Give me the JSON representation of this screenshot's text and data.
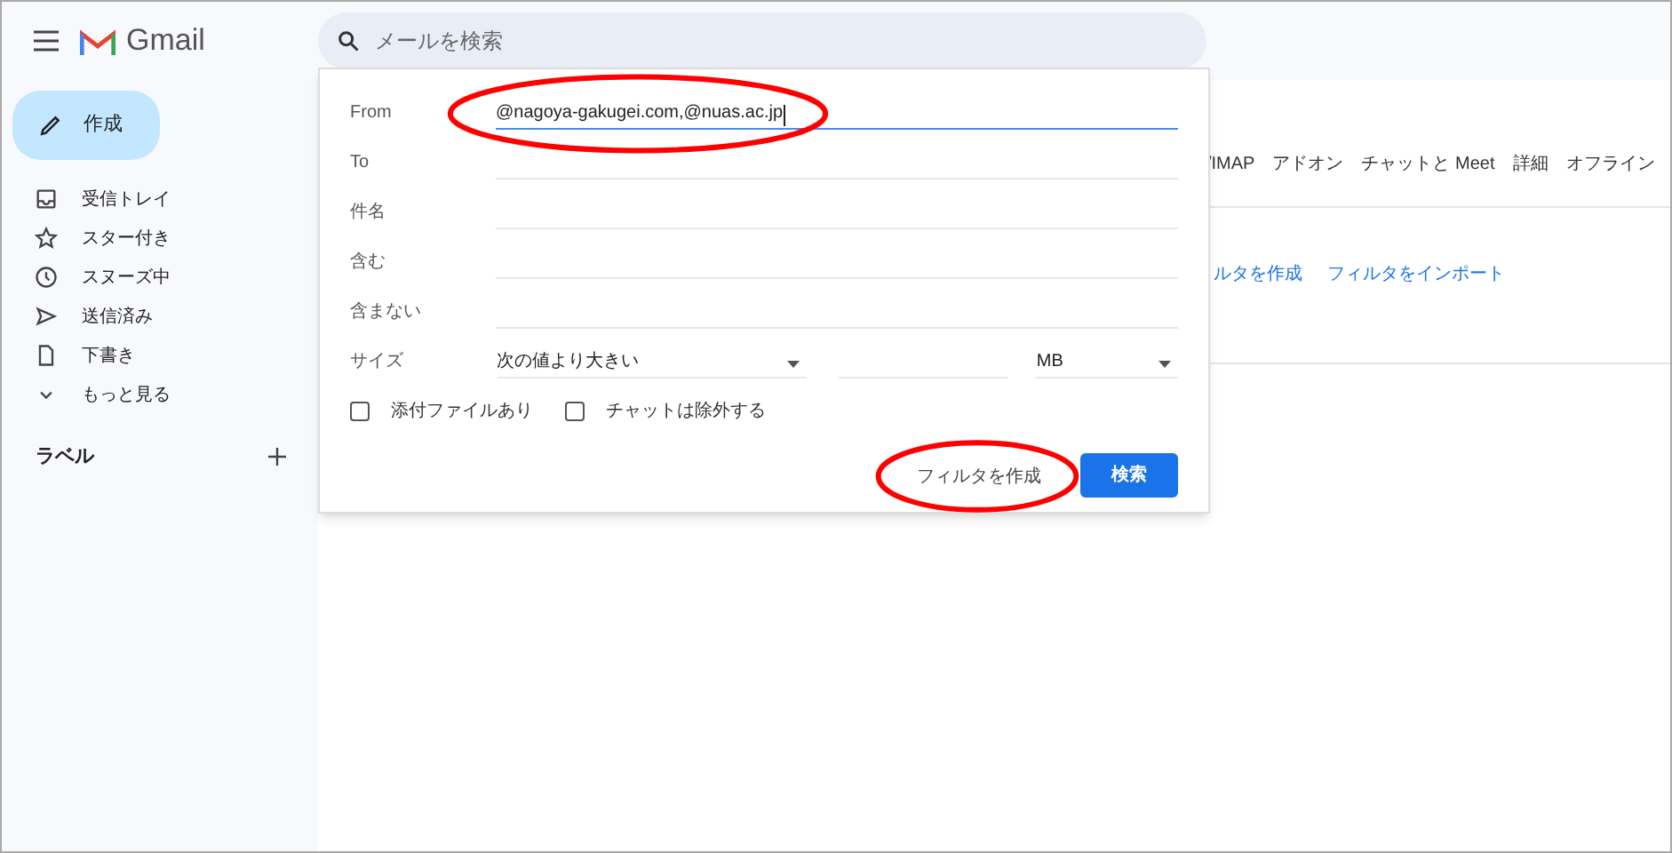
{
  "app": {
    "name": "Gmail"
  },
  "search": {
    "placeholder": "メールを検索"
  },
  "compose": {
    "label": "作成"
  },
  "nav": [
    {
      "kind": "inbox",
      "label": "受信トレイ"
    },
    {
      "kind": "star",
      "label": "スター付き"
    },
    {
      "kind": "clock",
      "label": "スヌーズ中"
    },
    {
      "kind": "send",
      "label": "送信済み"
    },
    {
      "kind": "draft",
      "label": "下書き"
    },
    {
      "kind": "more",
      "label": "もっと見る"
    }
  ],
  "labels": {
    "title": "ラベル"
  },
  "settings_tabs": [
    "/IMAP",
    "アドオン",
    "チャットと Meet",
    "詳細",
    "オフライン"
  ],
  "filter_links": [
    "ルタを作成",
    "フィルタをインポート"
  ],
  "search_options": {
    "fields": [
      {
        "label": "From",
        "value": "@nagoya-gakugei.com,@nuas.ac.jp",
        "focused": true,
        "highlighted": true
      },
      {
        "label": "To",
        "focused": false,
        "highlighted": false
      },
      {
        "label": "件名",
        "focused": false,
        "highlighted": false
      },
      {
        "label": "含む",
        "focused": false,
        "highlighted": false
      },
      {
        "label": "含まない",
        "focused": false,
        "highlighted": false
      }
    ],
    "size": {
      "label": "サイズ",
      "comparison": "次の値より大きい",
      "unit": "MB"
    },
    "checkboxes": [
      {
        "label": "添付ファイルあり",
        "checked": false
      },
      {
        "label": "チャットは除外する",
        "checked": false
      }
    ],
    "create_filter": {
      "label": "フィルタを作成",
      "highlighted": true
    },
    "search_button": {
      "label": "検索"
    }
  }
}
